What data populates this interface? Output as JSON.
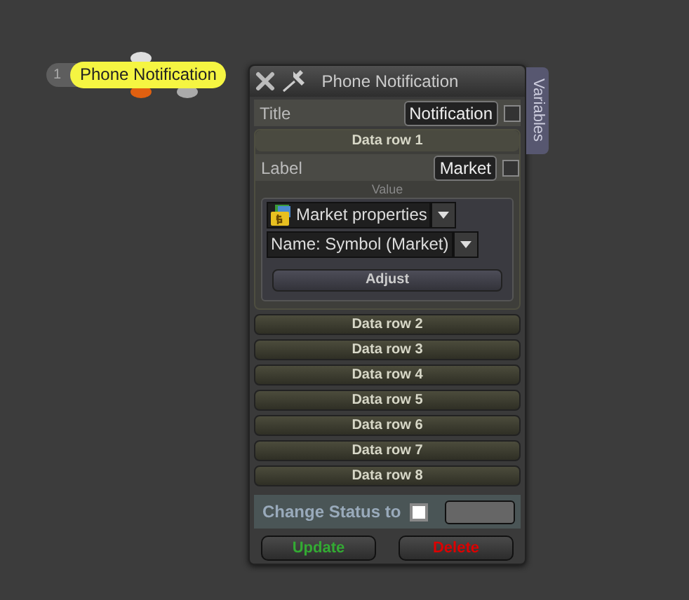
{
  "node": {
    "index": "1",
    "label": "Phone Notification"
  },
  "panel": {
    "title": "Phone Notification",
    "side_tab": "Variables",
    "title_field": {
      "label": "Title",
      "value": "Notification",
      "checked": false
    },
    "data_rows": [
      {
        "label": "Data row 1",
        "expanded": true,
        "field_label": "Label",
        "value": "Market",
        "checked": false,
        "value_caption": "Value",
        "source": "Market properties",
        "property": "Name: Symbol (Market)",
        "adjust": "Adjust"
      },
      {
        "label": "Data row 2",
        "expanded": false
      },
      {
        "label": "Data row 3",
        "expanded": false
      },
      {
        "label": "Data row 4",
        "expanded": false
      },
      {
        "label": "Data row 5",
        "expanded": false
      },
      {
        "label": "Data row 6",
        "expanded": false
      },
      {
        "label": "Data row 7",
        "expanded": false
      },
      {
        "label": "Data row 8",
        "expanded": false
      }
    ],
    "status": {
      "label": "Change Status to",
      "checked": false
    },
    "buttons": [
      {
        "label": "Update",
        "kind": "confirm"
      },
      {
        "label": "Delete",
        "kind": "danger"
      }
    ]
  }
}
